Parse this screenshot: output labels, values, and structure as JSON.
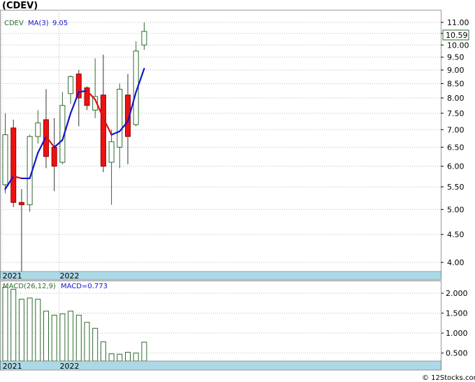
{
  "title": "(CDEV)",
  "legend": {
    "symbol": "CDEV",
    "ma_label": "MA(3)",
    "ma_value": "9.05",
    "macd_label": "MACD(26,12,9)",
    "macd_value": "MACD=0.773"
  },
  "last_price_label": "10.59",
  "watermark": "© 12Stocks.com",
  "colors": {
    "up_candle": "#2e6b2e",
    "down_candle": "#ee1111",
    "ma_up": "#1414cc",
    "ma_down": "#dd1111",
    "date_strip": "#add8e6",
    "grid": "#bbbbbb"
  },
  "chart_data": [
    {
      "type": "candlestick",
      "title": "(CDEV)",
      "scale": "log",
      "ylim": [
        3.85,
        11.6
      ],
      "y_ticks": [
        "4.00",
        "4.50",
        "5.00",
        "5.50",
        "6.00",
        "6.50",
        "7.00",
        "7.50",
        "8.00",
        "8.50",
        "9.00",
        "9.50",
        "10.00",
        "10.50",
        "11.00"
      ],
      "x_labels": [
        {
          "label": "2021",
          "index": 0
        },
        {
          "label": "2022",
          "index": 7
        }
      ],
      "candles": [
        {
          "open": 5.55,
          "high": 7.5,
          "low": 5.35,
          "close": 6.85
        },
        {
          "open": 7.05,
          "high": 7.3,
          "low": 5.05,
          "close": 5.15
        },
        {
          "open": 5.15,
          "high": 5.45,
          "low": 3.85,
          "close": 5.1
        },
        {
          "open": 5.1,
          "high": 6.85,
          "low": 4.95,
          "close": 6.8
        },
        {
          "open": 6.8,
          "high": 7.6,
          "low": 6.6,
          "close": 7.2
        },
        {
          "open": 7.3,
          "high": 8.3,
          "low": 5.95,
          "close": 6.25
        },
        {
          "open": 6.5,
          "high": 7.35,
          "low": 5.4,
          "close": 6.0
        },
        {
          "open": 6.1,
          "high": 8.2,
          "low": 6.05,
          "close": 7.75
        },
        {
          "open": 8.15,
          "high": 8.8,
          "low": 7.8,
          "close": 8.75
        },
        {
          "open": 8.85,
          "high": 9.0,
          "low": 7.1,
          "close": 8.0
        },
        {
          "open": 8.35,
          "high": 8.4,
          "low": 7.6,
          "close": 7.75
        },
        {
          "open": 7.6,
          "high": 9.45,
          "low": 7.35,
          "close": 8.05
        },
        {
          "open": 8.1,
          "high": 9.6,
          "low": 5.85,
          "close": 6.0
        },
        {
          "open": 6.1,
          "high": 7.0,
          "low": 5.1,
          "close": 6.65
        },
        {
          "open": 6.5,
          "high": 8.5,
          "low": 5.95,
          "close": 8.3
        },
        {
          "open": 8.1,
          "high": 8.85,
          "low": 6.05,
          "close": 6.8
        },
        {
          "open": 7.15,
          "high": 10.15,
          "low": 7.1,
          "close": 9.75
        },
        {
          "open": 10.0,
          "high": 11.0,
          "low": 9.8,
          "close": 10.59
        }
      ],
      "ma": {
        "name": "MA(3)",
        "values": [
          5.45,
          5.75,
          5.7,
          5.7,
          6.35,
          6.8,
          6.5,
          6.7,
          7.5,
          8.2,
          8.25,
          7.95,
          7.35,
          6.85,
          6.95,
          7.25,
          8.2,
          9.05
        ],
        "up_color": "#1414cc",
        "down_color": "#dd1111"
      }
    },
    {
      "type": "bar",
      "title": "MACD(26,12,9)",
      "ylim": [
        0.3,
        2.3
      ],
      "y_ticks": [
        "0.500",
        "1.000",
        "1.500",
        "2.000"
      ],
      "x_labels": [
        {
          "label": "2021",
          "index": 0
        },
        {
          "label": "2022",
          "index": 7
        }
      ],
      "values": [
        2.15,
        2.1,
        1.85,
        1.88,
        1.85,
        1.55,
        1.45,
        1.48,
        1.55,
        1.45,
        1.27,
        1.12,
        0.78,
        0.48,
        0.47,
        0.52,
        0.5,
        0.773
      ]
    }
  ]
}
